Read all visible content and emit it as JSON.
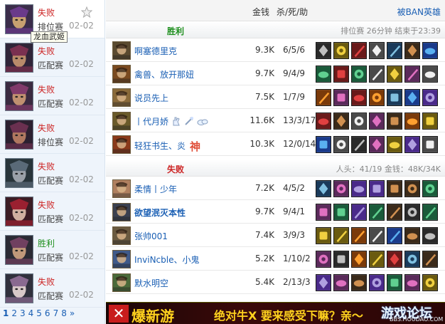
{
  "sidebar": {
    "tooltip": "龙血武姬",
    "matches": [
      {
        "result": "失败",
        "result_type": "loss",
        "mode": "排位赛",
        "date": "02-02",
        "selected": true
      },
      {
        "result": "失败",
        "result_type": "loss",
        "mode": "匹配赛",
        "date": "02-02"
      },
      {
        "result": "失败",
        "result_type": "loss",
        "mode": "匹配赛",
        "date": "02-02"
      },
      {
        "result": "失败",
        "result_type": "loss",
        "mode": "排位赛",
        "date": "02-02"
      },
      {
        "result": "失败",
        "result_type": "loss",
        "mode": "匹配赛",
        "date": "02-02"
      },
      {
        "result": "失败",
        "result_type": "loss",
        "mode": "匹配赛",
        "date": "02-02"
      },
      {
        "result": "胜利",
        "result_type": "win",
        "mode": "匹配赛",
        "date": "02-02"
      },
      {
        "result": "失败",
        "result_type": "loss",
        "mode": "匹配赛",
        "date": "02-02"
      }
    ],
    "pages": [
      "1",
      "2",
      "3",
      "4",
      "5",
      "6",
      "7",
      "8"
    ],
    "next": "»"
  },
  "header": {
    "gold": "金钱",
    "kda": "杀/死/助",
    "ban_link": "被BAN英雄"
  },
  "teams": [
    {
      "result": "胜利",
      "result_type": "win",
      "info": "排位赛  26分钟  结束于23:39",
      "players": [
        {
          "name": "啊塞德里克",
          "bold": false,
          "gold": "9.3K",
          "kda": "6/5/6"
        },
        {
          "name": "禽兽、放开那妞",
          "bold": false,
          "gold": "9.7K",
          "kda": "9/4/9"
        },
        {
          "name": "说员先上",
          "bold": false,
          "gold": "7.5K",
          "kda": "1/7/9"
        },
        {
          "name": "丨代月娇",
          "bold": false,
          "gold": "11.6K",
          "kda": "13/3/17",
          "badges": true
        },
        {
          "name": "轻狂书生、炎",
          "bold": false,
          "gold": "10.3K",
          "kda": "12/0/14",
          "god": "神"
        }
      ]
    },
    {
      "result": "失败",
      "result_type": "loss",
      "info": "人头：41/19  金钱：48K/34K",
      "players": [
        {
          "name": "柔情丨少年",
          "bold": false,
          "gold": "7.2K",
          "kda": "4/5/2"
        },
        {
          "name": "欲望泯灭本性",
          "bold": true,
          "gold": "9.7K",
          "kda": "9/4/1"
        },
        {
          "name": "张帅001",
          "bold": false,
          "gold": "7.4K",
          "kda": "3/9/3"
        },
        {
          "name": "InviNcble、小鬼",
          "bold": false,
          "gold": "5.2K",
          "kda": "1/10/2"
        },
        {
          "name": "默水明空",
          "bold": false,
          "gold": "5.4K",
          "kda": "2/13/3"
        }
      ]
    }
  ],
  "ad": {
    "brand": "爆新游",
    "slogan": "绝对牛X 要来感受下嘛？亲～",
    "watermark": "游戏论坛",
    "watermark_url": "BBS.HOUDAO.COM"
  },
  "colors": {
    "win": "#1e8f1e",
    "loss": "#cc2222",
    "link": "#1a5fb4",
    "ad_yellow": "#ffd21e"
  }
}
